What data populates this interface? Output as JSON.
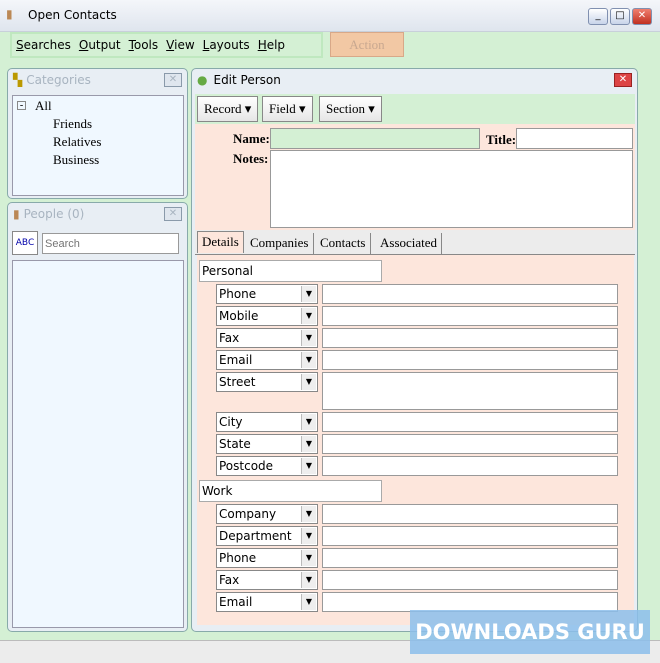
{
  "window": {
    "title": "Open Contacts"
  },
  "menu": [
    "Searches",
    "Output",
    "Tools",
    "View",
    "Layouts",
    "Help"
  ],
  "action_label": "Action",
  "categories": {
    "title": "Categories",
    "items": [
      "All",
      "Friends",
      "Relatives",
      "Business"
    ]
  },
  "people": {
    "title": "People",
    "count": "(0)",
    "search_placeholder": "Search",
    "sort_icon_text": "ABC"
  },
  "edit": {
    "title": "Edit Person",
    "toolbar": [
      "Record",
      "Field",
      "Section"
    ],
    "name_label": "Name:",
    "title_label": "Title:",
    "notes_label": "Notes:",
    "tabs": [
      "Details",
      "Companies",
      "Contacts",
      "Associated"
    ],
    "personal": {
      "label": "Personal",
      "fields": [
        "Phone",
        "Mobile",
        "Fax",
        "Email",
        "Street",
        "City",
        "State",
        "Postcode"
      ]
    },
    "work": {
      "label": "Work",
      "fields": [
        "Company",
        "Department",
        "Phone",
        "Fax",
        "Email"
      ]
    }
  },
  "watermark": "DOWNLOADS GURU"
}
